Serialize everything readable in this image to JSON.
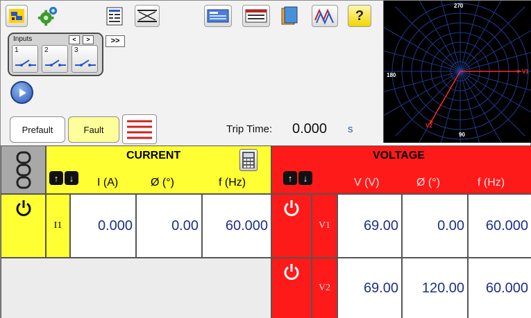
{
  "toolbar": {
    "icons": [
      "network-icon",
      "settings-gear-icon",
      "report-icon",
      "breaker-icon",
      "view-icon",
      "sequence-icon",
      "library-icon",
      "waveform-icon",
      "help-icon"
    ],
    "help_label": "?"
  },
  "inputs": {
    "label": "Inputs",
    "prev": "<",
    "next": ">",
    "expand": ">>",
    "items": [
      {
        "num": "1"
      },
      {
        "num": "2"
      },
      {
        "num": "3"
      }
    ]
  },
  "states": {
    "prefault": "Prefault",
    "fault": "Fault"
  },
  "trip": {
    "label": "Trip Time:",
    "value": "0.000",
    "unit": "s"
  },
  "vector_diagram": {
    "angle_top": "270",
    "angle_left": "180",
    "angle_bottom": "90",
    "v1_label": "V1",
    "v2_label": "V2",
    "vectors": [
      {
        "name": "V1",
        "angle_deg": 0,
        "magnitude": 69.0,
        "color": "#ff2a2a"
      },
      {
        "name": "V2",
        "angle_deg": 120,
        "magnitude": 69.0,
        "color": "#ff2a2a"
      }
    ]
  },
  "current": {
    "title": "CURRENT",
    "col_i": "I (A)",
    "col_phase": "Ø  (°)",
    "col_f": "f  (Hz)",
    "rows": [
      {
        "channel": "I1",
        "i": "0.000",
        "phase": "0.00",
        "f": "60.000"
      }
    ],
    "color": "#ffff33"
  },
  "voltage": {
    "title": "VOLTAGE",
    "col_v": "V (V)",
    "col_phase": "Ø  (°)",
    "col_f": "f  (Hz)",
    "rows": [
      {
        "channel": "V1",
        "v": "69.00",
        "phase": "0.00",
        "f": "60.000"
      },
      {
        "channel": "V2",
        "v": "69.00",
        "phase": "120.00",
        "f": "60.000"
      }
    ],
    "color": "#ff1a1a"
  }
}
